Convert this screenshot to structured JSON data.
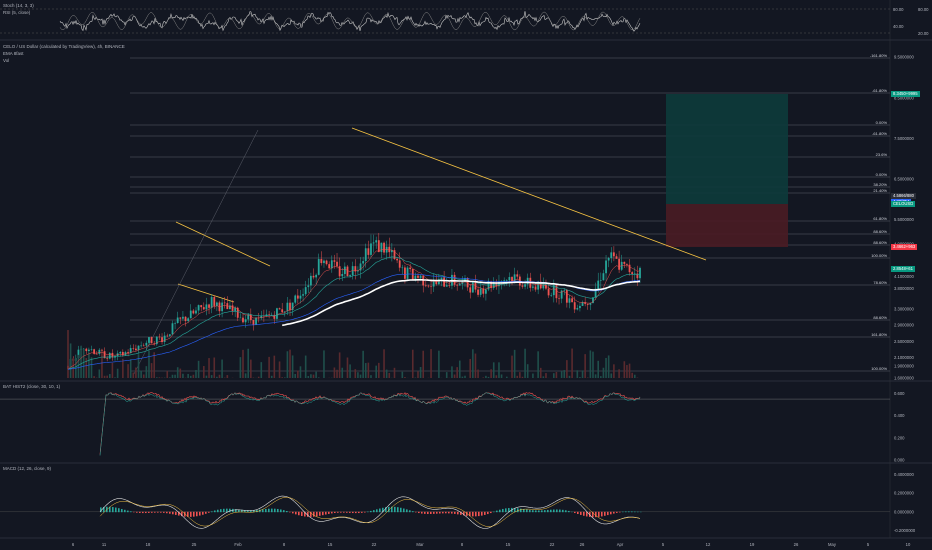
{
  "panes": {
    "top": {
      "title_1": "Stoch (14, 3, 3)",
      "title_2": "RSI (5, close)",
      "ticks": [
        "80.00",
        "40.00"
      ],
      "right_ticks": [
        "80.00",
        "20.00"
      ]
    },
    "main": {
      "symbol": "CELO / US Dollar (calculated by TradingView), 4h, BINANCE",
      "line2": "EMA 8fast",
      "line3": "Vol",
      "price_ticks": [
        "9.5000000",
        "8.5000000",
        "7.5000000",
        "6.5000000",
        "5.5000000",
        "4.9000000",
        "4.1000000",
        "3.8000000",
        "3.3000000",
        "2.9000000",
        "2.5000000",
        "2.1000000",
        "1.9000000",
        "1.6000000"
      ],
      "fib_labels": [
        "-161.80%",
        "-61.80%",
        "0.00%",
        "-61.80%",
        "23.6%",
        "0.00%",
        "38.20%",
        "21.40%",
        "61.80%",
        "88.60%",
        "88.60%",
        "100.00%",
        "78.60%",
        "88.60%",
        "161.80%",
        "100.00%"
      ],
      "price_tags": [
        {
          "text": "8.3450+9995",
          "color": "#089981"
        },
        {
          "text": "4.5866/880",
          "color": "#2a2e39"
        },
        {
          "text": "4.38/754",
          "color": "#2962ff"
        },
        {
          "text": "CELOUSD",
          "color": "#089981"
        },
        {
          "text": "3.4662+963",
          "color": "#f23645"
        },
        {
          "text": "2.8548+61",
          "color": "#089981"
        }
      ]
    },
    "osc": {
      "title": "BAT HIST2 (close, 30, 10, 1)",
      "ticks": [
        "0.600",
        "0.400",
        "0.200",
        "0.000"
      ]
    },
    "macd": {
      "title": "MACD (12, 26, close, 9)",
      "ticks": [
        "0.4000000",
        "0.2000000",
        "0.0000000",
        "-0.2000000"
      ]
    }
  },
  "time_axis": [
    "6",
    "11",
    "18",
    "25",
    "Feb",
    "8",
    "15",
    "22",
    "Mar",
    "8",
    "15",
    "22",
    "26",
    "Apr",
    "5",
    "12",
    "19",
    "26",
    "May",
    "5",
    "10"
  ],
  "chart_data": {
    "type": "candlestick",
    "title": "CELO / US Dollar (calculated by TradingView), 4h, BINANCE",
    "price_range": [
      1.6,
      9.8
    ],
    "approx_close_path": [
      1.9,
      2.4,
      2.2,
      2.1,
      2.3,
      2.5,
      2.6,
      3.0,
      3.2,
      3.5,
      3.3,
      3.1,
      3.0,
      3.2,
      3.4,
      3.9,
      4.6,
      4.2,
      4.3,
      4.9,
      4.8,
      4.2,
      4.1,
      3.9,
      4.0,
      3.9,
      3.8,
      4.0,
      4.1,
      3.9,
      3.8,
      3.7,
      3.4,
      3.6,
      4.6,
      4.3,
      4.2
    ],
    "colors": {
      "up": "#26a69a",
      "down": "#ef5350",
      "ema": "#ffffff",
      "trend": "#f6c343",
      "long_profit": "#0d3b3b",
      "long_loss": "#4a1c24"
    },
    "grid": false,
    "legend": "top-left"
  }
}
